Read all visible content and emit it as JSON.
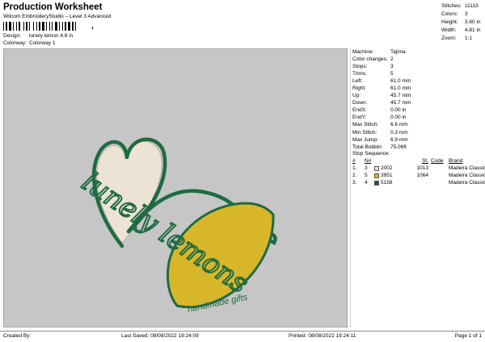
{
  "header": {
    "title": "Production Worksheet",
    "subtitle": "Wilcom EmbroideryStudio – Level 3 Advanced",
    "barcode_mark": ","
  },
  "meta": [
    {
      "label": "Design:",
      "value": "lunely lemon 4,8 in"
    },
    {
      "label": "Colorway:",
      "value": "Colorway 1"
    }
  ],
  "stats": [
    {
      "label": "Stitches:",
      "value": "11113"
    },
    {
      "label": "Colors:",
      "value": "3"
    },
    {
      "label": "Height:",
      "value": "3.60 in"
    },
    {
      "label": "Width:",
      "value": "4.81 in"
    },
    {
      "label": "Zoom:",
      "value": "1:1"
    }
  ],
  "machine": [
    {
      "label": "Machine:",
      "value": "Tajima"
    },
    {
      "label": "Color changes:",
      "value": "2"
    },
    {
      "label": "Stops:",
      "value": "3"
    },
    {
      "label": "Trims:",
      "value": "5"
    },
    {
      "label": "Left:",
      "value": "61.0 mm"
    },
    {
      "label": "Right:",
      "value": "61.0 mm"
    },
    {
      "label": "Up:",
      "value": "45.7 mm"
    },
    {
      "label": "Down:",
      "value": "45.7 mm"
    },
    {
      "label": "EndX:",
      "value": "0.00 in"
    },
    {
      "label": "EndY:",
      "value": "0.00 in"
    },
    {
      "label": "Max Stitch:",
      "value": "6.6 mm"
    },
    {
      "label": "Min Stitch:",
      "value": "0.3 mm"
    },
    {
      "label": "Max Jump:",
      "value": "6.9 mm"
    },
    {
      "label": "Total Bobbin:",
      "value": "75.06ft"
    }
  ],
  "stop_sequence": {
    "label": "Stop Sequence:",
    "headers": {
      "n": "#",
      "num": "N#",
      "st": "St.",
      "code": "Code",
      "brand": "Brand"
    },
    "rows": [
      {
        "n": "1.",
        "stop": "3",
        "color": "#ece3d5",
        "num": "2002",
        "st": "1013",
        "code": "",
        "brand": "Madeira Classic 40"
      },
      {
        "n": "2.",
        "stop": "5",
        "color": "#d8b62a",
        "num": "3951",
        "st": "1064",
        "code": "",
        "brand": "Madeira Classic 40"
      },
      {
        "n": "3.",
        "stop": "4",
        "color": "#1c5a3a",
        "num": "5158",
        "st": "",
        "code": "",
        "brand": "Madeira Classic 40"
      }
    ]
  },
  "design": {
    "script_text": "lunely lemons",
    "tagline": "handmade gifts",
    "colors": {
      "heart_fill": "#ece3d5",
      "lemon_fill": "#d8b62a",
      "outline": "#1f6b43"
    }
  },
  "footer": {
    "created_by": "Created By:",
    "last_saved": "Last Saved: 08/08/2022 19:24:09",
    "printed": "Printed: 08/08/2022 19:24:11",
    "page": "Page 1 of 1"
  }
}
